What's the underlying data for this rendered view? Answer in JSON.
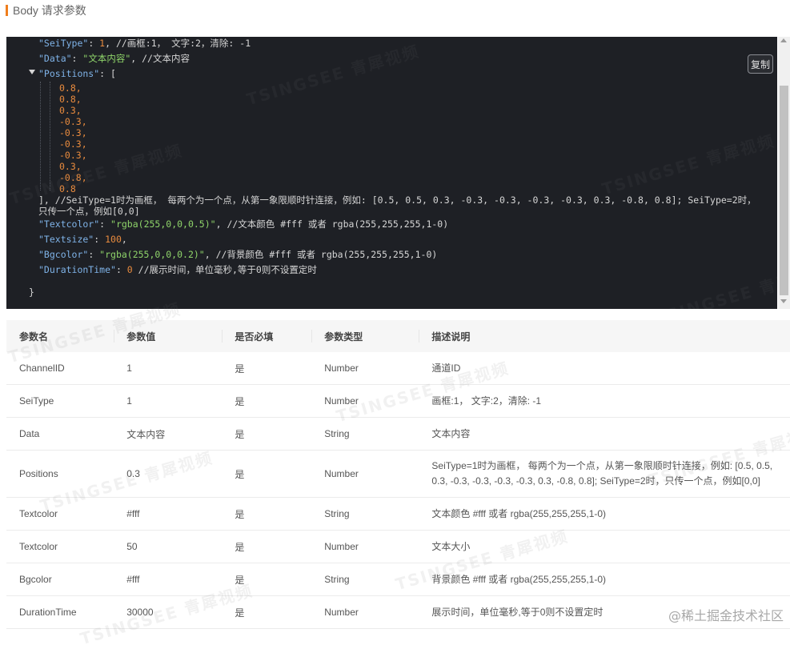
{
  "header": {
    "title": "Body 请求参数"
  },
  "code": {
    "copy_label": "复制",
    "line1": {
      "key": "\"SeiType\"",
      "sep": ": ",
      "value": "1",
      "comment": ", //画框:1， 文字:2，清除: -1"
    },
    "line2": {
      "key": "\"Data\"",
      "sep": ": ",
      "value": "\"文本内容\"",
      "comment": ", //文本内容"
    },
    "line3": {
      "key": "\"Positions\"",
      "sep": ": ["
    },
    "positions": [
      "0.8,",
      "0.8,",
      "0.3,",
      "-0.3,",
      "-0.3,",
      "-0.3,",
      "-0.3,",
      "0.3,",
      "-0.8,",
      "0.8"
    ],
    "positions_close": "], //SeiType=1时为画框， 每两个为一个点，从第一象限顺时针连接，例如: [0.5, 0.5, 0.3, -0.3, -0.3, -0.3, -0.3, 0.3, -0.8, 0.8]; SeiType=2时，",
    "positions_close2": "只传一个点，例如[0,0]",
    "line_textcolor": {
      "key": "\"Textcolor\"",
      "sep": ": ",
      "value": "\"rgba(255,0,0,0.5)\"",
      "comment": ", //文本颜色 #fff 或者 rgba(255,255,255,1-0)"
    },
    "line_textsize": {
      "key": "\"Textsize\"",
      "sep": ": ",
      "value": "100",
      "comment": ","
    },
    "line_bgcolor": {
      "key": "\"Bgcolor\"",
      "sep": ": ",
      "value": "\"rgba(255,0,0,0.2)\"",
      "comment": ", //背景颜色 #fff 或者 rgba(255,255,255,1-0)"
    },
    "line_duration": {
      "key": "\"DurationTime\"",
      "sep": ": ",
      "value": "0",
      "comment": " //展示时间，单位毫秒,等于0则不设置定时"
    },
    "closing_brace": "}"
  },
  "table": {
    "headers": [
      "参数名",
      "参数值",
      "是否必填",
      "参数类型",
      "描述说明"
    ],
    "rows": [
      [
        "ChannelID",
        "1",
        "是",
        "Number",
        "通道ID"
      ],
      [
        "SeiType",
        "1",
        "是",
        "Number",
        "画框:1， 文字:2，清除: -1"
      ],
      [
        "Data",
        "文本内容",
        "是",
        "String",
        "文本内容"
      ],
      [
        "Positions",
        "0.3",
        "是",
        "Number",
        "SeiType=1时为画框， 每两个为一个点，从第一象限顺时针连接，例如: [0.5, 0.5, 0.3, -0.3, -0.3, -0.3, -0.3, 0.3, -0.8, 0.8]; SeiType=2时，只传一个点，例如[0,0]"
      ],
      [
        "Textcolor",
        "#fff",
        "是",
        "String",
        "文本颜色 #fff 或者 rgba(255,255,255,1-0)"
      ],
      [
        "Textcolor",
        "50",
        "是",
        "Number",
        "文本大小"
      ],
      [
        "Bgcolor",
        "#fff",
        "是",
        "String",
        "背景颜色 #fff 或者 rgba(255,255,255,1-0)"
      ],
      [
        "DurationTime",
        "30000",
        "是",
        "Number",
        "展示时间，单位毫秒,等于0则不设置定时"
      ]
    ]
  },
  "watermark": "TSINGSEE 青犀视频",
  "footer_watermark": "@稀土掘金技术社区",
  "colors": {
    "accent": "#f07e1d",
    "code_bg": "#1e2025",
    "code_key": "#7fb3e8",
    "code_string": "#8fd46a",
    "code_number": "#e98b3e"
  }
}
